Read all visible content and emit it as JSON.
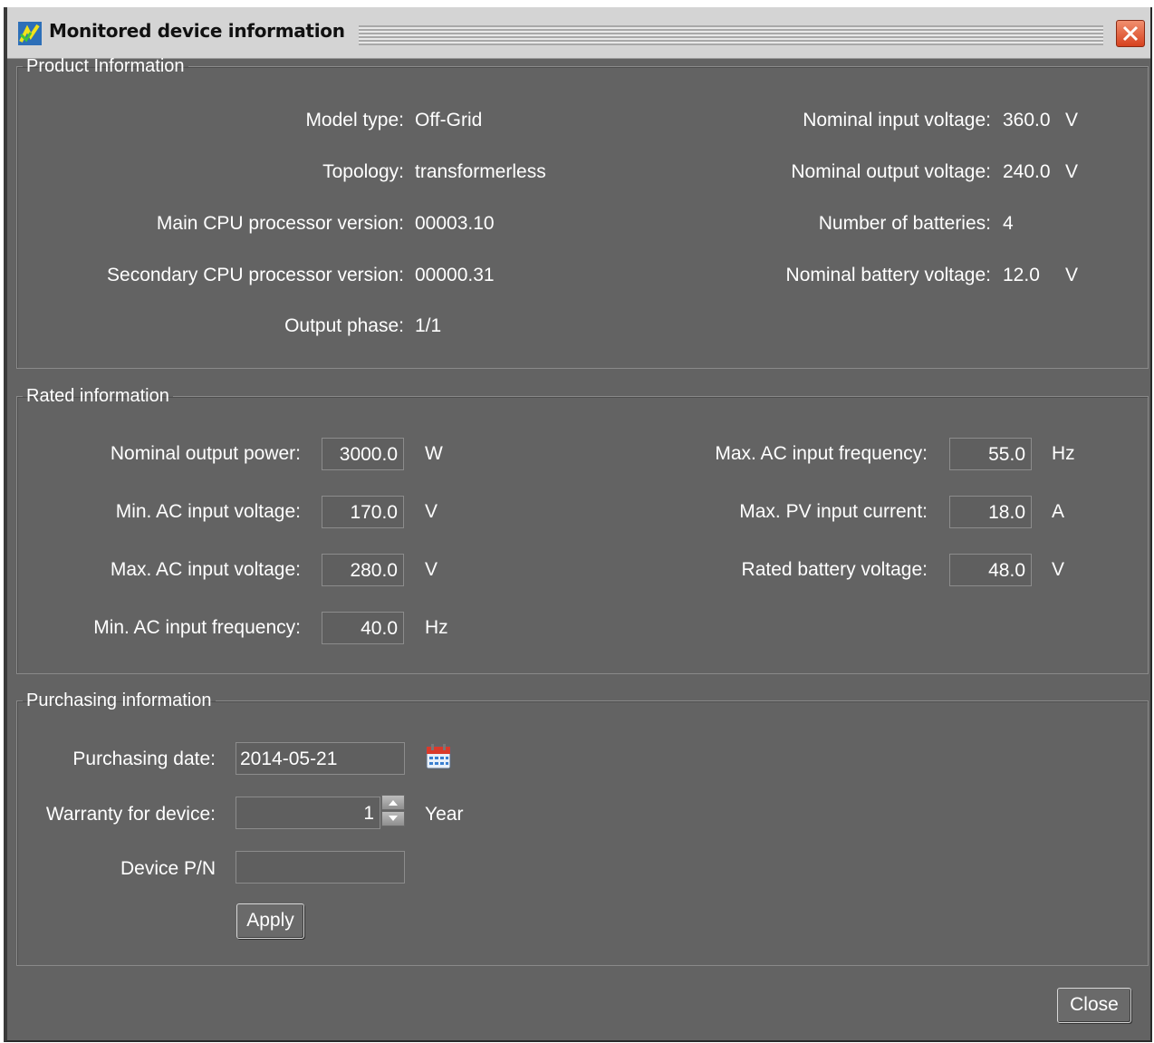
{
  "window": {
    "title": "Monitored device information"
  },
  "product": {
    "legend": "Product Information",
    "left": [
      {
        "label": "Model type:",
        "value": "Off-Grid"
      },
      {
        "label": "Topology:",
        "value": "transformerless"
      },
      {
        "label": "Main CPU processor version:",
        "value": "00003.10"
      },
      {
        "label": "Secondary CPU processor version:",
        "value": "00000.31"
      },
      {
        "label": "Output phase:",
        "value": "1/1"
      }
    ],
    "right": [
      {
        "label": "Nominal input voltage:",
        "value": "360.0",
        "unit": "V"
      },
      {
        "label": "Nominal output voltage:",
        "value": "240.0",
        "unit": "V"
      },
      {
        "label": "Number of batteries:",
        "value": "4",
        "unit": ""
      },
      {
        "label": "Nominal battery voltage:",
        "value": "12.0",
        "unit": "V"
      }
    ]
  },
  "rated": {
    "legend": "Rated information",
    "left": [
      {
        "label": "Nominal output power:",
        "value": "3000.0",
        "unit": "W"
      },
      {
        "label": "Min. AC input voltage:",
        "value": "170.0",
        "unit": "V"
      },
      {
        "label": "Max. AC input voltage:",
        "value": "280.0",
        "unit": "V"
      },
      {
        "label": "Min. AC input frequency:",
        "value": "40.0",
        "unit": "Hz"
      }
    ],
    "right": [
      {
        "label": "Max. AC input frequency:",
        "value": "55.0",
        "unit": "Hz"
      },
      {
        "label": "Max. PV input current:",
        "value": "18.0",
        "unit": "A"
      },
      {
        "label": "Rated battery voltage:",
        "value": "48.0",
        "unit": "V"
      }
    ]
  },
  "purchasing": {
    "legend": "Purchasing information",
    "date_label": "Purchasing date:",
    "date_value": "2014-05-21",
    "warranty_label": "Warranty for device:",
    "warranty_value": "1",
    "warranty_unit": "Year",
    "pn_label": "Device P/N",
    "pn_value": "",
    "apply_label": "Apply"
  },
  "footer": {
    "close_label": "Close"
  },
  "colors": {
    "window_bg": "#636363",
    "titlebar_bg": "#d4d4d4",
    "close_accent": "#d7421f"
  }
}
